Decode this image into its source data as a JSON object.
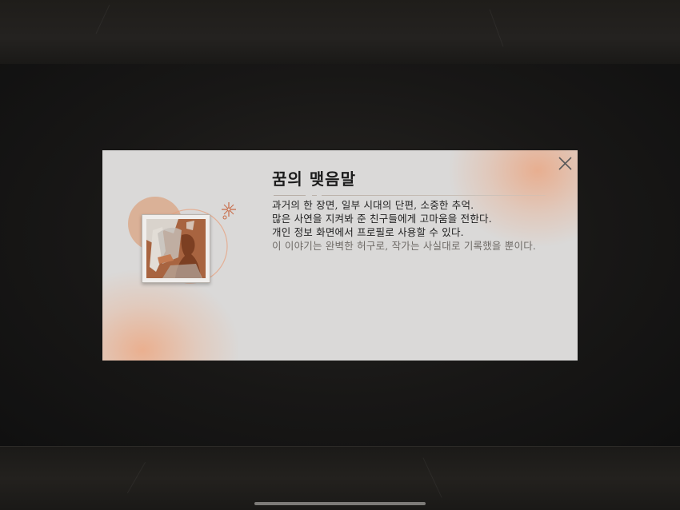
{
  "dialog": {
    "title": "꿈의 맺음말",
    "lines": [
      "과거의 한 장면, 일부 시대의 단편, 소중한 추억.",
      "많은 사연을 지켜봐 준 친구들에게 고마움을 전한다.",
      "개인 정보 화면에서 프로필로 사용할 수 있다."
    ],
    "note": "이 이야기는 완벽한 허구로, 작가는 사실대로 기록했을 뿐이다."
  },
  "icons": {
    "close": "close-x-icon",
    "portrait": "profile-portrait-icon",
    "sparkle": "sparkle-icon"
  },
  "colors": {
    "dialog_bg": "#dad9d8",
    "accent": "#e8a07a",
    "text": "#222222",
    "muted_text": "#6f6b67"
  }
}
